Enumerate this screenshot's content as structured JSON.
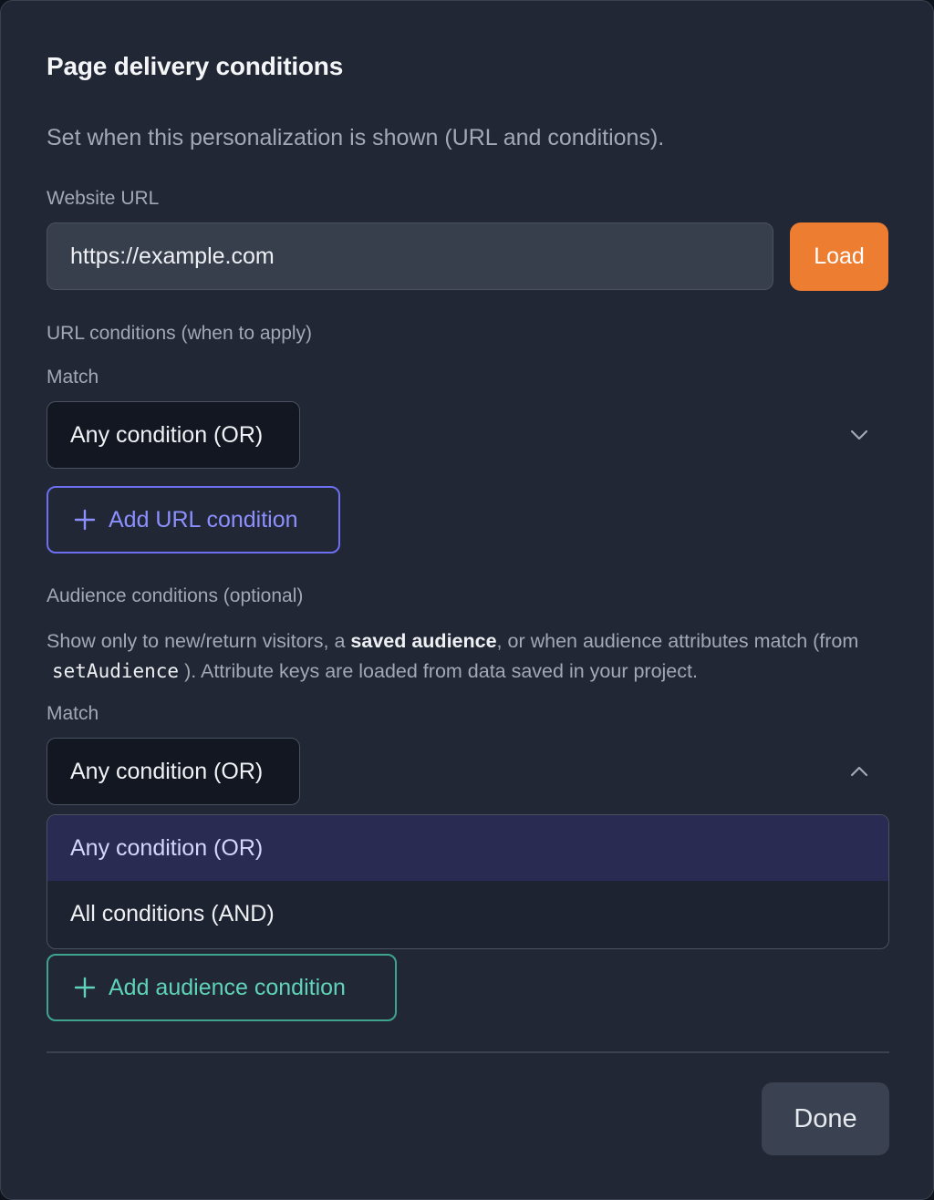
{
  "dialog": {
    "title": "Page delivery conditions",
    "subtitle": "Set when this personalization is shown (URL and conditions)."
  },
  "website_url": {
    "label": "Website URL",
    "value": "https://example.com",
    "load_label": "Load"
  },
  "url_conditions": {
    "heading": "URL conditions (when to apply)",
    "match_label": "Match",
    "match_value": "Any condition (OR)",
    "add_label": "Add URL condition"
  },
  "audience_conditions": {
    "heading": "Audience conditions (optional)",
    "desc_part1": "Show only to new/return visitors, a ",
    "desc_bold": "saved audience",
    "desc_part2": ", or when audience attributes match (from ",
    "desc_code": "setAudience",
    "desc_part3": "). Attribute keys are loaded from data saved in your project.",
    "match_label": "Match",
    "match_value": "Any condition (OR)",
    "options": [
      "Any condition (OR)",
      "All conditions (AND)"
    ],
    "selected_option": "Any condition (OR)",
    "add_label": "Add audience condition"
  },
  "footer": {
    "done_label": "Done"
  },
  "colors": {
    "accent_orange": "#ed7d30",
    "url_add_accent": "#8c90ff",
    "audience_add_accent": "#5fd3b8",
    "background": "#212734"
  }
}
